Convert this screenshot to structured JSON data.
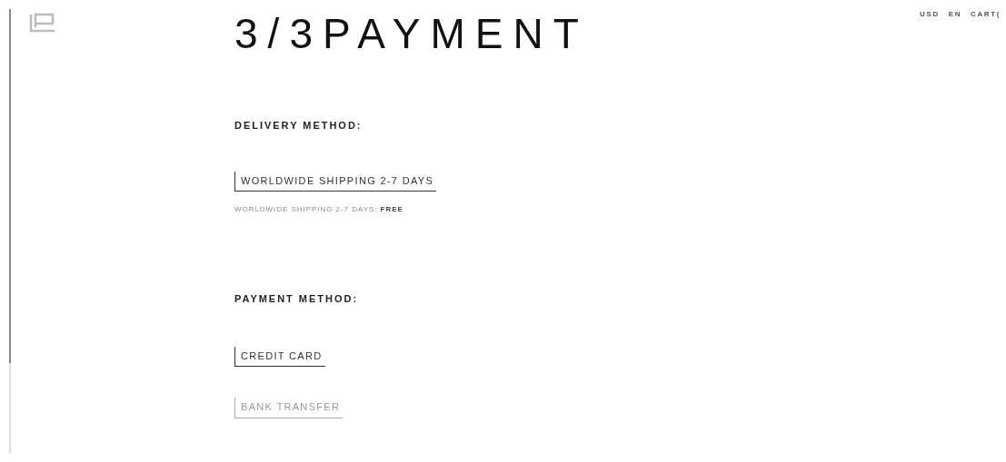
{
  "header": {
    "title": "3/3PAYMENT",
    "nav": [
      "USD",
      "EN",
      "CART("
    ]
  },
  "delivery": {
    "heading": "DELIVERY METHOD:",
    "options": [
      {
        "label": "WORLDWIDE SHIPPING 2-7 DAYS",
        "selected": true
      }
    ],
    "note": "WORLDWIDE SHIPPING 2-7 DAYS: **FREE**"
  },
  "payment": {
    "heading": "PAYMENT METHOD:",
    "options": [
      {
        "label": "CREDIT CARD",
        "selected": true
      },
      {
        "label": "BANK TRANSFER",
        "selected": false
      }
    ]
  }
}
